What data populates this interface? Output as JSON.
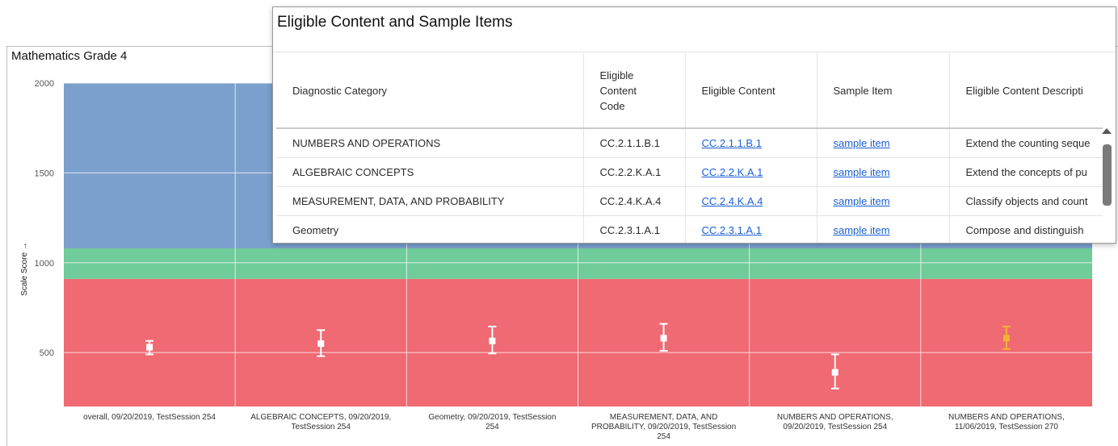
{
  "chart_data": {
    "type": "scatter",
    "title": "Mathematics Grade 4",
    "ylabel": "Scale Score",
    "ylim": [
      200,
      2000
    ],
    "yticks": [
      500,
      1000,
      1500,
      2000
    ],
    "bands": [
      {
        "from": 200,
        "to": 910,
        "color": "#ef6a73"
      },
      {
        "from": 910,
        "to": 1080,
        "color": "#70cc9a"
      },
      {
        "from": 1080,
        "to": 2000,
        "color": "#7ba0cd"
      }
    ],
    "categories": [
      [
        "overall, 09/20/2019, TestSession 254"
      ],
      [
        "ALGEBRAIC CONCEPTS, 09/20/2019,",
        "TestSession 254"
      ],
      [
        "Geometry, 09/20/2019, TestSession",
        "254"
      ],
      [
        "MEASUREMENT, DATA, AND",
        "PROBABILITY, 09/20/2019, TestSession",
        "254"
      ],
      [
        "NUMBERS AND OPERATIONS,",
        "09/20/2019, TestSession 254"
      ],
      [
        "NUMBERS AND OPERATIONS,",
        "11/06/2019, TestSession 270"
      ]
    ],
    "points": [
      {
        "y": 530,
        "low": 490,
        "high": 565,
        "color": "#ffffff"
      },
      {
        "y": 550,
        "low": 480,
        "high": 625,
        "color": "#ffffff"
      },
      {
        "y": 565,
        "low": 495,
        "high": 645,
        "color": "#ffffff"
      },
      {
        "y": 580,
        "low": 510,
        "high": 660,
        "color": "#ffffff"
      },
      {
        "y": 390,
        "low": 300,
        "high": 490,
        "color": "#ffffff"
      },
      {
        "y": 580,
        "low": 520,
        "high": 645,
        "color": "#f5b233"
      }
    ]
  },
  "modal": {
    "title": "Eligible Content and Sample Items",
    "headers": {
      "category": "Diagnostic Category",
      "code_line1": "Eligible",
      "code_line2": "Content",
      "code_line3": "Code",
      "content": "Eligible Content",
      "sample": "Sample Item",
      "description": "Eligible Content Descripti"
    },
    "rows": [
      {
        "category": "NUMBERS AND OPERATIONS",
        "code": "CC.2.1.1.B.1",
        "content": "CC.2.1.1.B.1",
        "sample": "sample item",
        "description": "Extend the counting seque"
      },
      {
        "category": "ALGEBRAIC CONCEPTS",
        "code": "CC.2.2.K.A.1",
        "content": "CC.2.2.K.A.1",
        "sample": "sample item",
        "description": "Extend the concepts of pu"
      },
      {
        "category": "MEASUREMENT, DATA, AND PROBABILITY",
        "code": "CC.2.4.K.A.4",
        "content": "CC.2.4.K.A.4",
        "sample": "sample item",
        "description": "Classify objects and count"
      },
      {
        "category": "Geometry",
        "code": "CC.2.3.1.A.1",
        "content": "CC.2.3.1.A.1",
        "sample": "sample item",
        "description": "Compose and distinguish"
      }
    ]
  }
}
